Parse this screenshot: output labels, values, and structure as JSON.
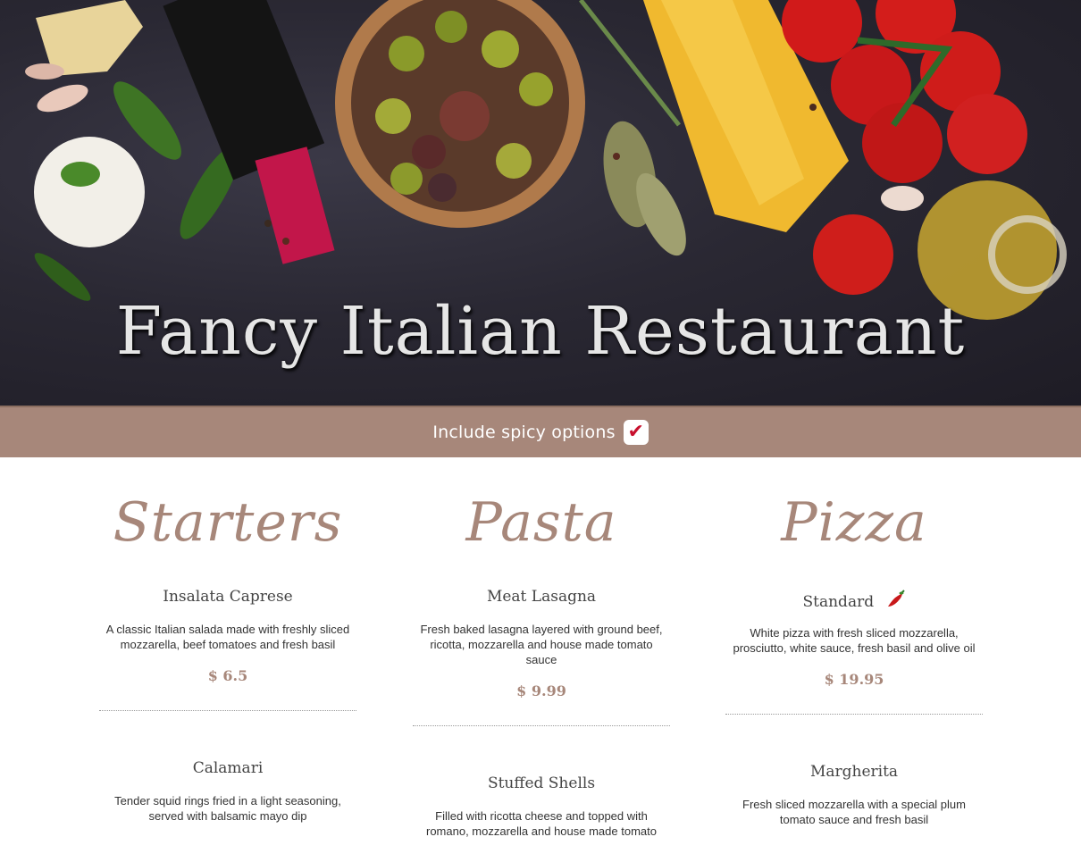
{
  "hero": {
    "title": "Fancy Italian Restaurant"
  },
  "filter": {
    "label": "Include spicy options",
    "checked": true,
    "check_glyph": "✔"
  },
  "colors": {
    "accent": "#a7877a",
    "bar": "#a7877a",
    "check": "#c8102e"
  },
  "columns": [
    {
      "title": "Starters",
      "items": [
        {
          "name": "Insalata Caprese",
          "spicy": false,
          "desc": "A classic Italian salada made with freshly sliced mozzarella, beef tomatoes and fresh basil",
          "price": "$ 6.5"
        },
        {
          "name": "Calamari",
          "spicy": false,
          "desc": "Tender squid rings fried in a light seasoning, served with balsamic mayo dip",
          "price": ""
        }
      ]
    },
    {
      "title": "Pasta",
      "items": [
        {
          "name": "Meat Lasagna",
          "spicy": false,
          "desc": "Fresh baked lasagna layered with ground beef, ricotta, mozzarella and house made tomato sauce",
          "price": "$ 9.99"
        },
        {
          "name": "Stuffed Shells",
          "spicy": false,
          "desc": "Filled with ricotta cheese and topped with romano, mozzarella and house made tomato",
          "price": ""
        }
      ]
    },
    {
      "title": "Pizza",
      "items": [
        {
          "name": "Standard",
          "spicy": true,
          "spicy_icon": "chili-pepper-icon",
          "desc": "White pizza with fresh sliced mozzarella, prosciutto, white sauce, fresh basil and olive oil",
          "price": "$ 19.95"
        },
        {
          "name": "Margherita",
          "spicy": false,
          "desc": "Fresh sliced mozzarella with a special plum tomato sauce and fresh basil",
          "price": ""
        }
      ]
    }
  ]
}
